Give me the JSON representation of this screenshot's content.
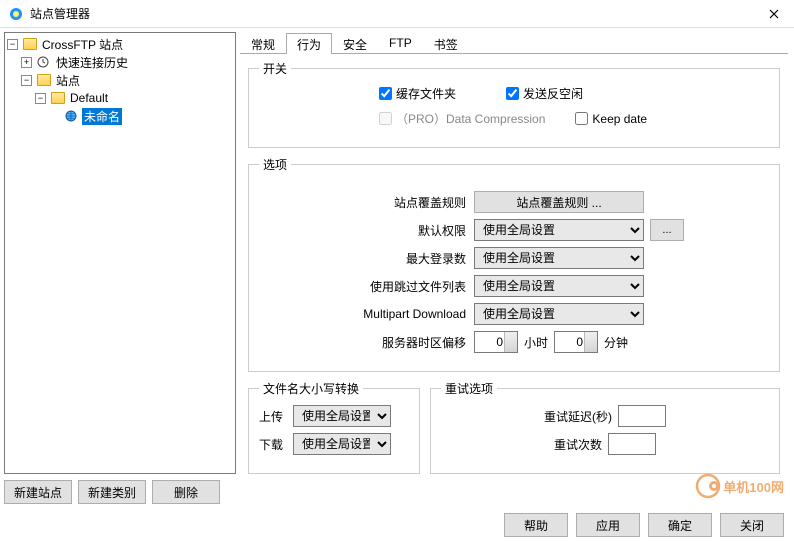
{
  "window": {
    "title": "站点管理器"
  },
  "tree": {
    "root": "CrossFTP 站点",
    "history": "快速连接历史",
    "sites": "站点",
    "default": "Default",
    "unnamed": "未命名"
  },
  "left_buttons": {
    "new_site": "新建站点",
    "new_alias": "新建类别",
    "delete": "删除"
  },
  "tabs": {
    "general": "常规",
    "behavior": "行为",
    "security": "安全",
    "ftp": "FTP",
    "bookmark": "书签"
  },
  "switch_group": {
    "legend": "开关",
    "cache_folder": "缓存文件夹",
    "send_antiidle": "发送反空闲",
    "pro_compression": "（PRO）Data Compression",
    "keep_date": "Keep date"
  },
  "options_group": {
    "legend": "选项",
    "site_override_label": "站点覆盖规则",
    "site_override_btn": "站点覆盖规则 ...",
    "default_perm": "默认权限",
    "max_login": "最大登录数",
    "skip_file_list": "使用跳过文件列表",
    "multipart_download": "Multipart Download",
    "use_global": "使用全局设置",
    "tz_offset": "服务器时区偏移",
    "tz_hour_val": "0",
    "tz_hour_lbl": "小时",
    "tz_min_val": "0",
    "tz_min_lbl": "分钟",
    "ellipsis": "..."
  },
  "case_group": {
    "legend": "文件名大小写转换",
    "upload": "上传",
    "download": "下载",
    "use_global": "使用全局设置"
  },
  "retry_group": {
    "legend": "重试选项",
    "retry_delay": "重试延迟(秒)",
    "retry_count": "重试次数"
  },
  "footer": {
    "help": "帮助",
    "apply": "应用",
    "ok": "确定",
    "close": "关闭"
  },
  "watermark": "单机100网"
}
